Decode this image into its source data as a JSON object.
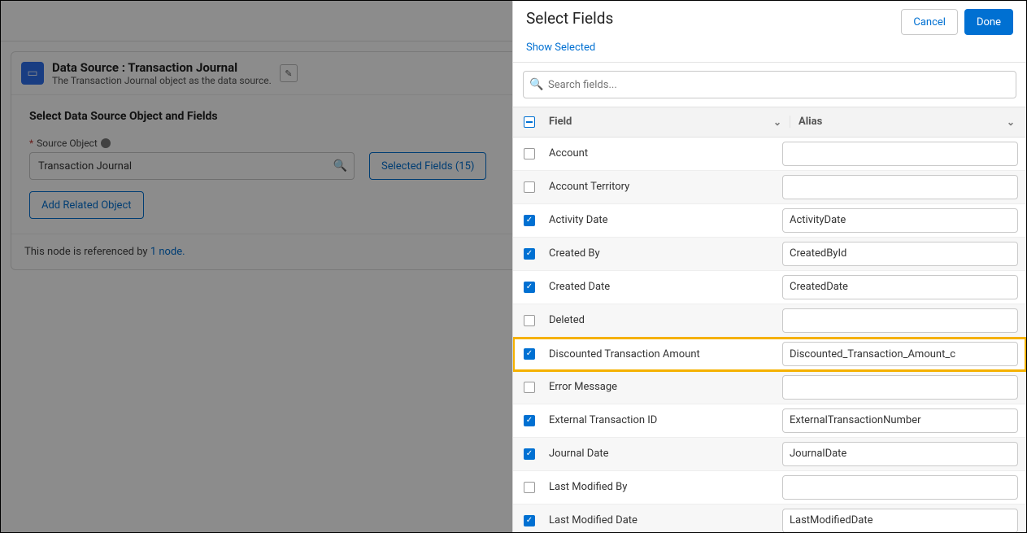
{
  "background": {
    "card_title": "Data Source :  Transaction Journal",
    "card_sub": "The Transaction Journal object as the data source.",
    "section_title": "Select Data Source Object and Fields",
    "source_label": "Source Object",
    "source_value": "Transaction Journal",
    "selected_fields_btn": "Selected Fields (15)",
    "add_related_btn": "Add Related Object",
    "footer_prefix": "This node is referenced by ",
    "footer_link": "1 node."
  },
  "panel": {
    "title": "Select Fields",
    "cancel": "Cancel",
    "done": "Done",
    "show_selected": "Show Selected",
    "search_placeholder": "Search fields...",
    "header_field": "Field",
    "header_alias": "Alias"
  },
  "rows": [
    {
      "label": "Account",
      "checked": false,
      "alias": "",
      "zebra": false,
      "hl": false
    },
    {
      "label": "Account Territory",
      "checked": false,
      "alias": "",
      "zebra": true,
      "hl": false
    },
    {
      "label": "Activity Date",
      "checked": true,
      "alias": "ActivityDate",
      "zebra": false,
      "hl": false
    },
    {
      "label": "Created By",
      "checked": true,
      "alias": "CreatedById",
      "zebra": true,
      "hl": false
    },
    {
      "label": "Created Date",
      "checked": true,
      "alias": "CreatedDate",
      "zebra": false,
      "hl": false
    },
    {
      "label": "Deleted",
      "checked": false,
      "alias": "",
      "zebra": true,
      "hl": false
    },
    {
      "label": "Discounted Transaction Amount",
      "checked": true,
      "alias": "Discounted_Transaction_Amount_c",
      "zebra": false,
      "hl": true
    },
    {
      "label": "Error Message",
      "checked": false,
      "alias": "",
      "zebra": true,
      "hl": false
    },
    {
      "label": "External Transaction ID",
      "checked": true,
      "alias": "ExternalTransactionNumber",
      "zebra": false,
      "hl": false
    },
    {
      "label": "Journal Date",
      "checked": true,
      "alias": "JournalDate",
      "zebra": true,
      "hl": false
    },
    {
      "label": "Last Modified By",
      "checked": false,
      "alias": "",
      "zebra": false,
      "hl": false
    },
    {
      "label": "Last Modified Date",
      "checked": true,
      "alias": "LastModifiedDate",
      "zebra": true,
      "hl": false
    }
  ]
}
